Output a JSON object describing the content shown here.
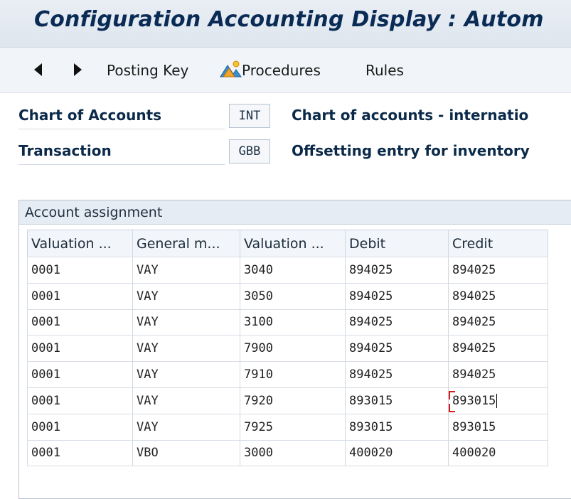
{
  "window": {
    "title": "Configuration Accounting Display : Autom"
  },
  "toolbar": {
    "back_icon": "triangle-left-icon",
    "forward_icon": "triangle-right-icon",
    "posting_key_label": "Posting Key",
    "procedures_label": "Procedures",
    "procedures_icon": "mountains-icon",
    "rules_label": "Rules"
  },
  "header": {
    "fields": [
      {
        "label": "Chart of Accounts",
        "value": "INT",
        "description": "Chart of accounts - internatio"
      },
      {
        "label": "Transaction",
        "value": "GBB",
        "description": "Offsetting entry for inventory"
      }
    ]
  },
  "account_assignment": {
    "title": "Account assignment",
    "columns": [
      "Valuation ...",
      "General m...",
      "Valuation ...",
      "Debit",
      "Credit"
    ],
    "rows": [
      [
        "0001",
        "VAY",
        "3040",
        "894025",
        "894025"
      ],
      [
        "0001",
        "VAY",
        "3050",
        "894025",
        "894025"
      ],
      [
        "0001",
        "VAY",
        "3100",
        "894025",
        "894025"
      ],
      [
        "0001",
        "VAY",
        "7900",
        "894025",
        "894025"
      ],
      [
        "0001",
        "VAY",
        "7910",
        "894025",
        "894025"
      ],
      [
        "0001",
        "VAY",
        "7920",
        "893015",
        "893015"
      ],
      [
        "0001",
        "VAY",
        "7925",
        "893015",
        "893015"
      ],
      [
        "0001",
        "VBO",
        "3000",
        "400020",
        "400020"
      ]
    ],
    "focused_cell": {
      "row": 5,
      "column": 4
    }
  },
  "colors": {
    "title_text": "#0a2b55",
    "label_text": "#0b2a4a",
    "focus_bracket": "#d91a1a"
  }
}
